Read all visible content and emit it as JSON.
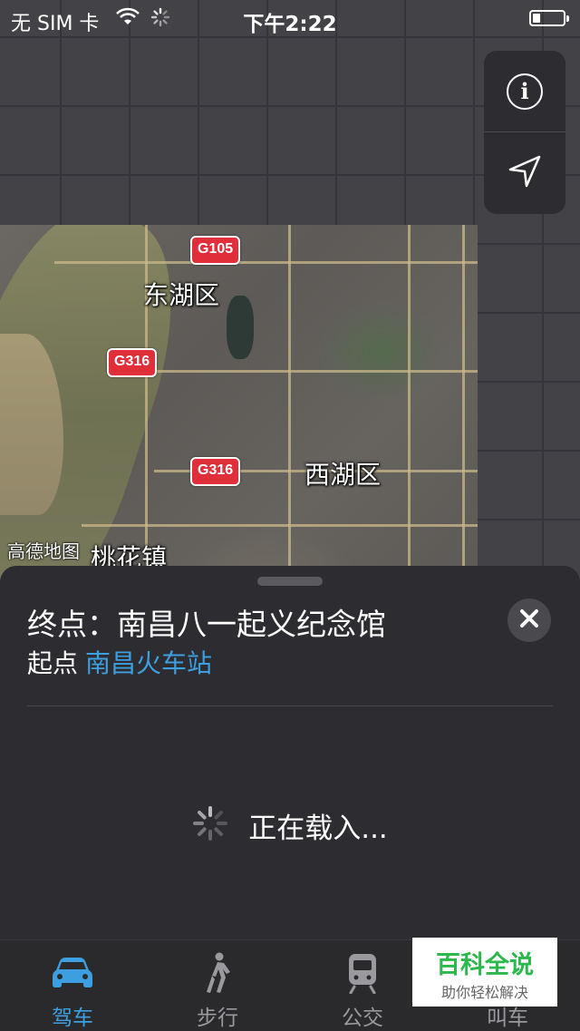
{
  "status_bar": {
    "carrier": "无 SIM 卡",
    "time": "下午2:22"
  },
  "map": {
    "shields": [
      "G105",
      "G316",
      "G316"
    ],
    "districts": [
      "东湖区",
      "西湖区",
      "桃花镇"
    ],
    "attribution": "高德地图"
  },
  "map_controls": {
    "info_icon": "info-icon",
    "location_icon": "location-arrow-icon"
  },
  "route": {
    "destination": "终点：南昌八一起义纪念馆",
    "origin_label": "起点",
    "origin_value": "南昌火车站",
    "loading_text": "正在载入..."
  },
  "tabs": [
    {
      "label": "驾车",
      "icon": "car-icon",
      "active": true
    },
    {
      "label": "步行",
      "icon": "walk-icon",
      "active": false
    },
    {
      "label": "公交",
      "icon": "train-icon",
      "active": false
    },
    {
      "label": "叫车",
      "icon": "taxi-icon",
      "active": false
    }
  ],
  "watermark": {
    "title": "百科全说",
    "subtitle": "助你轻松解决"
  },
  "colors": {
    "accent": "#3d9fe0",
    "shield": "#e02f3a",
    "watermark_green": "#2db84d"
  }
}
